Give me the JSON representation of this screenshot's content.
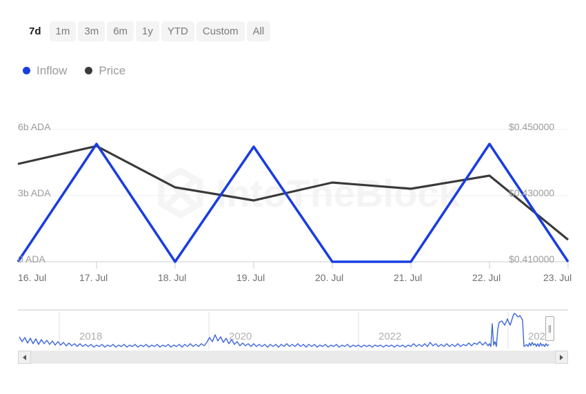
{
  "range_selector": {
    "options": [
      {
        "label": "7d",
        "selected": true
      },
      {
        "label": "1m",
        "selected": false
      },
      {
        "label": "3m",
        "selected": false
      },
      {
        "label": "6m",
        "selected": false
      },
      {
        "label": "1y",
        "selected": false
      },
      {
        "label": "YTD",
        "selected": false
      },
      {
        "label": "Custom",
        "selected": false
      },
      {
        "label": "All",
        "selected": false
      }
    ]
  },
  "legend": {
    "items": [
      {
        "label": "Inflow",
        "color": "#1a3de0"
      },
      {
        "label": "Price",
        "color": "#3a3a3a"
      }
    ]
  },
  "watermark": {
    "text": "IntoTheBlock",
    "logo": "intotheblock-logo-icon"
  },
  "chart_data": {
    "type": "line",
    "title": "",
    "xlabel": "",
    "grid": true,
    "legend_position": "top-left",
    "categories": [
      "16. Jul",
      "17. Jul",
      "18. Jul",
      "19. Jul",
      "20. Jul",
      "21. Jul",
      "22. Jul",
      "23. Jul"
    ],
    "y_left": {
      "label": "ADA",
      "ticks": [
        "0 ADA",
        "3b ADA",
        "6b ADA"
      ],
      "tick_values": [
        0,
        3000000000,
        6000000000
      ],
      "ylim": [
        0,
        6000000000
      ]
    },
    "y_right": {
      "label": "Price",
      "ticks": [
        "$0.410000",
        "$0.430000",
        "$0.450000"
      ],
      "tick_values": [
        0.41,
        0.43,
        0.45
      ],
      "ylim": [
        0.404,
        0.4565
      ]
    },
    "series": [
      {
        "name": "Inflow",
        "color": "#1a3de0",
        "axis": "left",
        "unit": "ADA",
        "values": [
          0,
          5350000000,
          0,
          5230000000,
          0,
          0,
          5350000000,
          0
        ]
      },
      {
        "name": "Price",
        "color": "#3a3a3a",
        "axis": "right",
        "unit": "USD",
        "values": [
          0.4372,
          0.4427,
          0.4302,
          0.4262,
          0.4318,
          0.4299,
          0.434,
          0.4145
        ]
      }
    ]
  },
  "navigator": {
    "year_labels": [
      "2018",
      "2020",
      "2022",
      "2024"
    ],
    "series_color": "#3a64dd",
    "handle": "navigator-right-handle",
    "scroll_left": "scroll-left-arrow",
    "scroll_right": "scroll-right-arrow"
  }
}
